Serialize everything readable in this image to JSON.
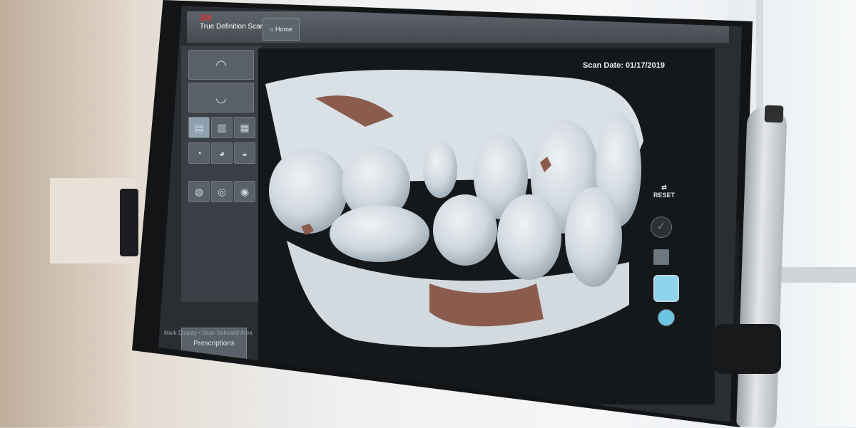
{
  "scene": {
    "monitor_brand": "3M",
    "app_logo_small": "3M",
    "app_name": "True Definition Scanner",
    "home_label": "Home",
    "scan_date_label": "Scan Date: 01/17/2019",
    "reset_label": "RESET",
    "left_button_label": "Prescriptions",
    "status_text": "Mark Display • Scan Selected Area"
  },
  "colors": {
    "screen_bg": "#2a2e33",
    "panel": "#3a3f45",
    "accent_blue": "#8fd3ec",
    "tooth_shade": "#d6dde3",
    "gum_tone": "#8b5c4d",
    "brand_red": "#a3191f"
  },
  "icons": [
    "home-icon",
    "arch-icon",
    "tooth-icon",
    "check-icon",
    "grid-icon",
    "face-icon",
    "tooth-select-icon",
    "reset-arrows-icon"
  ]
}
